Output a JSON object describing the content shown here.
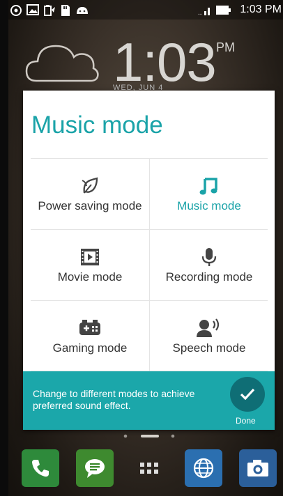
{
  "status_bar": {
    "time": "1:03 PM",
    "icons": [
      "settings-icon",
      "image-icon",
      "battery-saver-icon",
      "sd-card-icon",
      "android-icon",
      "signal-icon",
      "battery-icon"
    ]
  },
  "home": {
    "clock": "1:03",
    "ampm": "PM",
    "date": "WED, JUN 4"
  },
  "dialog": {
    "title": "Music mode",
    "modes": [
      {
        "label": "Power saving mode",
        "icon": "leaf-icon",
        "active": false
      },
      {
        "label": "Music mode",
        "icon": "music-note-icon",
        "active": true
      },
      {
        "label": "Movie mode",
        "icon": "film-icon",
        "active": false
      },
      {
        "label": "Recording mode",
        "icon": "microphone-icon",
        "active": false
      },
      {
        "label": "Gaming mode",
        "icon": "gamepad-icon",
        "active": false
      },
      {
        "label": "Speech mode",
        "icon": "speaker-person-icon",
        "active": false
      }
    ],
    "hint": "Change to different modes to achieve preferred sound effect.",
    "done_label": "Done"
  },
  "dock": {
    "apps": [
      "phone-icon",
      "messages-icon",
      "app-drawer-icon",
      "browser-icon",
      "camera-icon"
    ]
  },
  "colors": {
    "accent": "#1aa3a8",
    "bar": "#1ba7aa",
    "done_button": "#0f6e75"
  }
}
